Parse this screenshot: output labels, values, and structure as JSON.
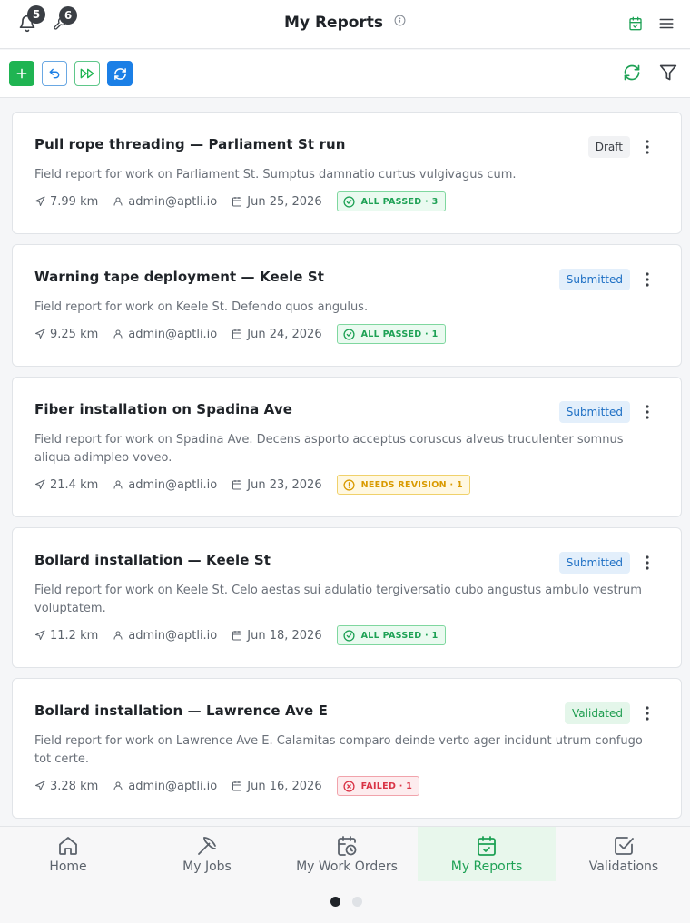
{
  "header": {
    "title": "My Reports",
    "notifications_count": "5",
    "tasks_count": "6"
  },
  "colors": {
    "accent_green": "#1fb452",
    "accent_blue": "#1b7fe6"
  },
  "reports": [
    {
      "title": "Pull rope threading — Parliament St run",
      "status": "Draft",
      "status_kind": "draft",
      "description": "Field report for work on Parliament St. Sumptus damnatio curtus vulgivagus cum.",
      "distance": "7.99 km",
      "user": "admin@aptli.io",
      "date": "Jun 25, 2026",
      "validation": "ALL PASSED · 3",
      "validation_kind": "passed"
    },
    {
      "title": "Warning tape deployment — Keele St",
      "status": "Submitted",
      "status_kind": "submitted",
      "description": "Field report for work on Keele St. Defendo quos angulus.",
      "distance": "9.25 km",
      "user": "admin@aptli.io",
      "date": "Jun 24, 2026",
      "validation": "ALL PASSED · 1",
      "validation_kind": "passed"
    },
    {
      "title": "Fiber installation on Spadina Ave",
      "status": "Submitted",
      "status_kind": "submitted",
      "description": "Field report for work on Spadina Ave. Decens asporto acceptus coruscus alveus truculenter somnus aliqua adimpleo voveo.",
      "distance": "21.4 km",
      "user": "admin@aptli.io",
      "date": "Jun 23, 2026",
      "validation": "NEEDS REVISION · 1",
      "validation_kind": "revision"
    },
    {
      "title": "Bollard installation — Keele St",
      "status": "Submitted",
      "status_kind": "submitted",
      "description": "Field report for work on Keele St. Celo aestas sui adulatio tergiversatio cubo angustus ambulo vestrum voluptatem.",
      "distance": "11.2 km",
      "user": "admin@aptli.io",
      "date": "Jun 18, 2026",
      "validation": "ALL PASSED · 1",
      "validation_kind": "passed"
    },
    {
      "title": "Bollard installation — Lawrence Ave E",
      "status": "Validated",
      "status_kind": "validated",
      "description": "Field report for work on Lawrence Ave E. Calamitas comparo deinde verto ager incidunt utrum confugo tot certe.",
      "distance": "3.28 km",
      "user": "admin@aptli.io",
      "date": "Jun 16, 2026",
      "validation": "FAILED · 1",
      "validation_kind": "failed"
    }
  ],
  "nav": {
    "items": [
      {
        "label": "Home",
        "icon": "home-icon"
      },
      {
        "label": "My Jobs",
        "icon": "pickaxe-icon"
      },
      {
        "label": "My Work Orders",
        "icon": "calendar-clock-icon"
      },
      {
        "label": "My Reports",
        "icon": "calendar-check-icon"
      },
      {
        "label": "Validations",
        "icon": "checkbox-icon"
      }
    ],
    "active_index": 3
  },
  "pager": {
    "total_pages": 2,
    "current_page": 1
  }
}
